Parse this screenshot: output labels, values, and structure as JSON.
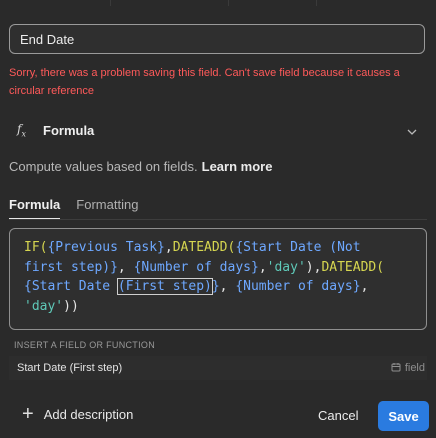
{
  "field": {
    "name_value": "End Date",
    "error": "Sorry, there was a problem saving this field. Can't save field because it causes a circular reference"
  },
  "type": {
    "icon": "fx-icon",
    "label": "Formula"
  },
  "description": {
    "text": "Compute values based on fields.",
    "link": "Learn more"
  },
  "tabs": [
    {
      "label": "Formula",
      "active": true
    },
    {
      "label": "Formatting",
      "active": false
    }
  ],
  "formula": {
    "line1": [
      {
        "t": "IF(",
        "c": "fn"
      },
      {
        "t": "{Previous Task}",
        "c": "ref"
      },
      {
        "t": ",",
        "c": "br"
      },
      {
        "t": "DATEADD(",
        "c": "fn"
      },
      {
        "t": "{Start Date (Not",
        "c": "ref"
      }
    ],
    "line2": [
      {
        "t": "first step)}",
        "c": "ref"
      },
      {
        "t": ", ",
        "c": "br"
      },
      {
        "t": "{Number of days}",
        "c": "ref"
      },
      {
        "t": ",",
        "c": "br"
      },
      {
        "t": "'day'",
        "c": "str"
      },
      {
        "t": "),",
        "c": "br"
      },
      {
        "t": "DATEADD(",
        "c": "fn"
      }
    ],
    "line3": [
      {
        "t": "{Start Date ",
        "c": "ref"
      },
      {
        "t": "(First step)",
        "c": "ref",
        "box": true
      },
      {
        "t": "}",
        "c": "ref"
      },
      {
        "t": ", ",
        "c": "br"
      },
      {
        "t": "{Number of days}",
        "c": "ref"
      },
      {
        "t": ",",
        "c": "br"
      }
    ],
    "line4": [
      {
        "t": "'day'",
        "c": "str"
      },
      {
        "t": "))",
        "c": "br"
      }
    ]
  },
  "insert": {
    "label": "INSERT A FIELD OR FUNCTION",
    "suggestion": "Start Date (First step)",
    "kind": "field",
    "kind_icon": "calendar-icon"
  },
  "footer": {
    "add_description": "Add description",
    "cancel": "Cancel",
    "save": "Save"
  },
  "colors": {
    "accent": "#2a7be0",
    "error": "#ff5a5a",
    "function": "#d6d650",
    "field_ref": "#6ea8ff",
    "string": "#5fc9b8"
  }
}
